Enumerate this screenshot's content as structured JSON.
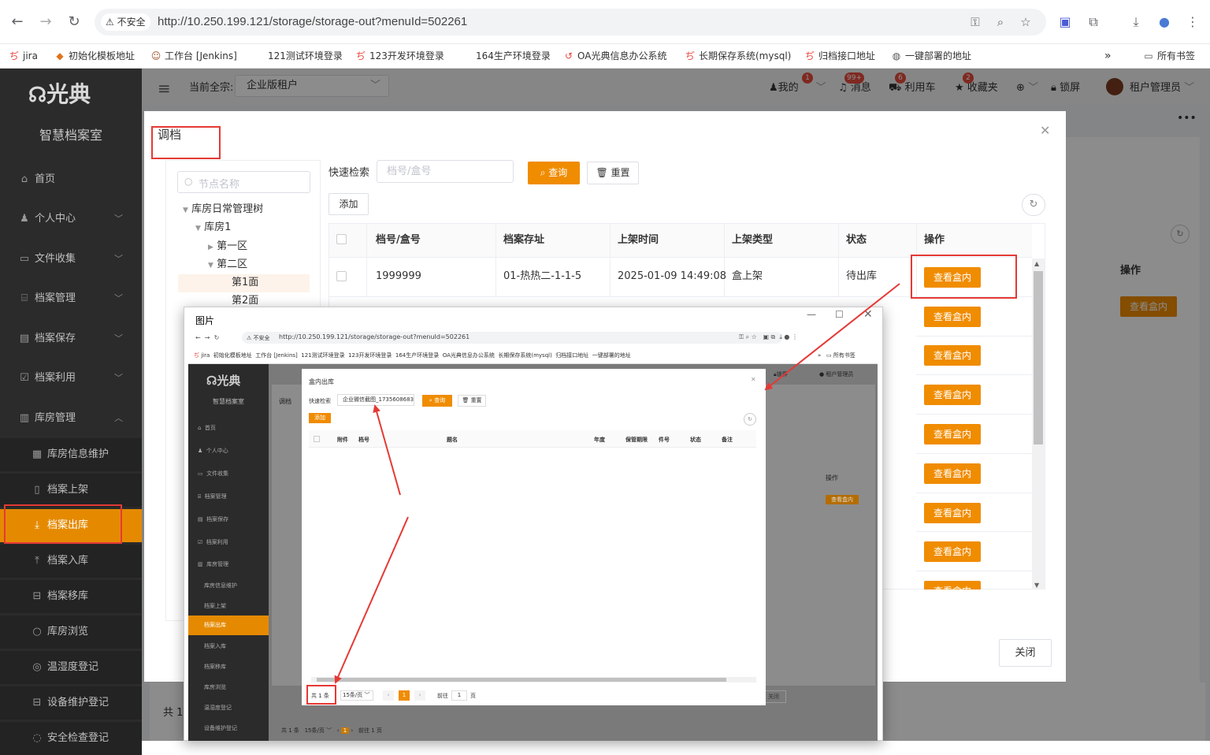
{
  "browser": {
    "insecure_label": "不安全",
    "url": "http://10.250.199.121/storage/storage-out?menuId=502261",
    "bookmarks": [
      "jira",
      "初始化模板地址",
      "工作台 [Jenkins]",
      "121测试环境登录",
      "123开发环境登录",
      "164生产环境登录",
      "OA光典信息办公系统",
      "长期保存系统(mysql)",
      "归档接口地址",
      "一键部署的地址"
    ],
    "more": "»",
    "all_bookmarks": "所有书签"
  },
  "app": {
    "logo": "光典",
    "name": "智慧档案室",
    "header": {
      "current_label": "当前全宗:",
      "current_value": "企业版租户",
      "my": "我的",
      "my_badge": "1",
      "messages": "消息",
      "messages_badge": "99+",
      "cart": "利用车",
      "cart_badge": "6",
      "favorites": "收藏夹",
      "favorites_badge": "2",
      "lock": "锁屏",
      "user": "租户管理员"
    },
    "menu": [
      "首页",
      "个人中心",
      "文件收集",
      "档案管理",
      "档案保存",
      "档案利用",
      "库房管理"
    ],
    "submenu": [
      "库房信息维护",
      "档案上架",
      "档案出库",
      "档案入库",
      "档案移库",
      "库房浏览",
      "温湿度登记",
      "设备维护登记",
      "安全检查登记"
    ]
  },
  "background_page": {
    "op_header": "操作",
    "op_button": "查看盒内",
    "total": "共 1"
  },
  "dialog": {
    "title": "调档",
    "tree_search_placeholder": "节点名称",
    "tree": [
      "库房日常管理树",
      "库房1",
      "第一区",
      "第二区",
      "第1面",
      "第2面"
    ],
    "quick_search_label": "快速检索",
    "quick_search_placeholder": "档号/盒号",
    "query_button": "查询",
    "reset_button": "重置",
    "add_button": "添加",
    "columns": [
      "档号/盒号",
      "档案存址",
      "上架时间",
      "上架类型",
      "状态",
      "操作"
    ],
    "rows": [
      {
        "code": "1999999",
        "location": "01-热热二-1-1-5",
        "time": "2025-01-09 14:49:08",
        "type": "盒上架",
        "status": "待出库",
        "op": "查看盒内"
      }
    ],
    "extra_op_buttons": [
      "查看盒内",
      "查看盒内",
      "查看盒内",
      "查看盒内",
      "查看盒内",
      "查看盒内",
      "查看盒内",
      "查看盒内"
    ],
    "close_button": "关闭"
  },
  "image_window": {
    "title": "图片",
    "inner_dialog": {
      "title": "盒内出库",
      "quick_search_label": "快速检索",
      "search_value": "企业微信截图_17356086834",
      "query_button": "查询",
      "reset_button": "重置",
      "add_button": "添加",
      "columns": [
        "附件",
        "档号",
        "题名",
        "年度",
        "保管期限",
        "件号",
        "状态",
        "备注"
      ],
      "total": "共 1 条",
      "page_size": "15条/页",
      "page": "1",
      "goto_label": "前往",
      "goto_value": "1",
      "page_unit": "页"
    },
    "bg_close": "关闭",
    "bg_op_header": "操作",
    "bg_op_button": "查看盒内",
    "bg_total": "共 1 条",
    "bg_page_size": "15条/页",
    "bg_page": "1",
    "bg_goto": "前往",
    "bg_goto_value": "1",
    "bg_unit": "页",
    "bg_dialog_title": "调档",
    "in_menu": [
      "首页",
      "个人中心",
      "文件收集",
      "档案管理",
      "档案保存",
      "档案利用",
      "库房管理",
      "库房信息维护",
      "档案上架",
      "档案出库",
      "档案入库",
      "档案移库",
      "库房浏览",
      "温湿度登记",
      "设备维护登记"
    ],
    "in_header": {
      "lock": "锁屏",
      "user": "租户管理员"
    }
  }
}
